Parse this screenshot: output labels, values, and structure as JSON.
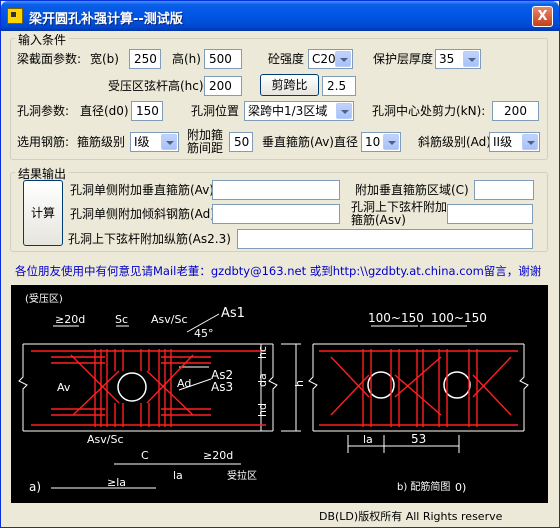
{
  "window": {
    "title": "梁开圆孔补强计算--测试版",
    "close_label": "X"
  },
  "input_group": {
    "legend": "输入条件",
    "section_label": "梁截面参数:",
    "width_label": "宽(b)",
    "width_value": "250",
    "height_label": "高(h)",
    "height_value": "500",
    "concrete_label": "砼强度",
    "concrete_value": "C20",
    "cover_label": "保护层厚度",
    "cover_value": "35",
    "hc_label": "受压区弦杆高(hc)",
    "hc_value": "200",
    "span_ratio_button": "剪跨比",
    "span_ratio_value": "2.5",
    "hole_label": "孔洞参数:",
    "diameter_label": "直径(d0)",
    "diameter_value": "150",
    "position_label": "孔洞位置",
    "position_value": "梁跨中1/3区域",
    "shear_label": "孔洞中心处剪力(kN):",
    "shear_value": "200",
    "rebar_label": "选用钢筋:",
    "stirrup_grade_label": "箍筋级别",
    "stirrup_grade_value": "I级",
    "extra_stirrup_label": "附加箍筋间距",
    "extra_stirrup_value": "50",
    "vertical_label": "垂直箍筋(Av)直径",
    "vertical_value": "10",
    "diagonal_grade_label": "斜筋级别(Ad)",
    "diagonal_grade_value": "II级"
  },
  "result_group": {
    "legend": "结果输出",
    "calc_button": "计算",
    "av_label": "孔洞单侧附加垂直箍筋(Av)",
    "av_value": "",
    "c_label": "附加垂直箍筋区域(C)",
    "c_value": "",
    "ad_label": "孔洞单侧附加倾斜钢筋(Ad)",
    "ad_value": "",
    "asv_label": "孔洞上下弦杆附加箍筋(Asv)",
    "asv_value": "",
    "as23_label": "孔洞上下弦杆附加纵筋(As2.3)",
    "as23_value": ""
  },
  "info_text": "各位朋友使用中有何意见请Mail老董：gzdbty@163.net 或到http:\\\\gzdbty.at.china.com留言，谢谢",
  "diagram": {
    "label_a_region": "(受压区)",
    "label_20d_left": "≥20d",
    "label_sc": "Sc",
    "label_asv_sc_top": "Asv/Sc",
    "label_as1": "As1",
    "label_45": "45°",
    "label_as2": "As2",
    "label_as3": "As3",
    "label_av": "Av",
    "label_ad": "Ad",
    "label_hc": "hc",
    "label_da": "da",
    "label_h": "h",
    "label_hd": "hd",
    "label_asv_sc_bottom": "Asv/Sc",
    "label_c": "C",
    "label_20d_bottom": "≥20d",
    "label_la_left": "≥la",
    "label_la_mid": "la",
    "label_tension": "受拉区",
    "label_a": "a)",
    "label_100_150_a": "100~150",
    "label_100_150_b": "100~150",
    "label_la_right": "la",
    "label_53": "53",
    "label_b": "b) 配筋简图",
    "label_b_tail": "0)"
  },
  "footer": "DB(LD)版权所有 All Rights reserve",
  "colors": {
    "title_bar": "#0055e5",
    "link_blue": "#0000c8",
    "diagram_bg": "#000000",
    "diagram_lines": "#ffffff",
    "rebar_red": "#ff2020"
  }
}
